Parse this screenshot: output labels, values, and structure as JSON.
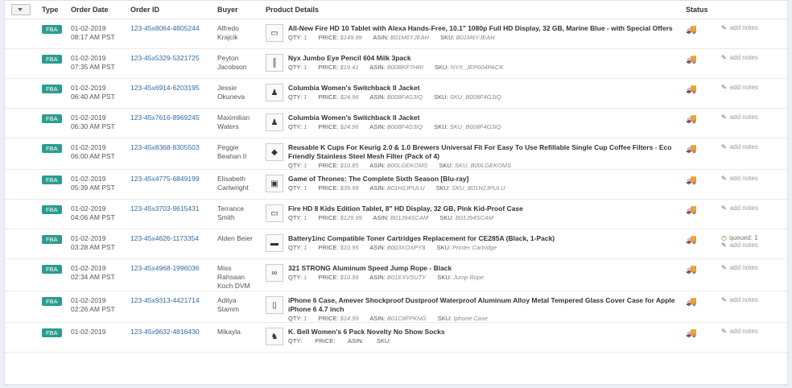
{
  "header": {
    "type": "Type",
    "order_date": "Order Date",
    "order_id": "Order ID",
    "buyer": "Buyer",
    "product_details": "Product Details",
    "status": "Status"
  },
  "labels": {
    "qty": "QTY:",
    "price": "PRICE:",
    "asin": "ASIN:",
    "sku": "SKU:",
    "add_notes": "add notes"
  },
  "colors": {
    "fba_badge": "#2a9d8f",
    "link": "#2f6aa5",
    "truck": "#6b9a2a"
  },
  "orders": [
    {
      "type": "FBA",
      "date": "01-02-2019",
      "time": "08:17 AM PST",
      "id": "123-45x8064-4805244",
      "buyer": "Alfredo Krajcik",
      "product": "All-New Fire HD 10 Tablet with Alexa Hands-Free, 10.1\" 1080p Full HD Display, 32 GB, Marine Blue - with Special Offers",
      "qty": "1",
      "price": "$149.99",
      "asin": "B01M6YJEAH",
      "sku": "B01M6YJEAH",
      "icon": "tablet-icon",
      "queued": ""
    },
    {
      "type": "FBA",
      "date": "01-02-2019",
      "time": "07:35 AM PST",
      "id": "123-45x5329-5321725",
      "buyer": "Peyton Jacobson",
      "product": "Nyx Jumbo Eye Pencil 604 Milk 3pack",
      "qty": "1",
      "price": "$19.41",
      "asin": "B00BKF7HRI",
      "sku": "NYX_JEP604PACK",
      "icon": "pencil-icon",
      "queued": ""
    },
    {
      "type": "FBA",
      "date": "01-02-2019",
      "time": "06:40 AM PST",
      "id": "123-45x6914-6203195",
      "buyer": "Jessie Okuneva",
      "product": "Columbia Women's Switchback II Jacket",
      "qty": "1",
      "price": "$24.96",
      "asin": "B008F4G3IQ",
      "sku": "SKU_B008F4G3IQ",
      "icon": "jacket-icon",
      "queued": ""
    },
    {
      "type": "FBA",
      "date": "01-02-2019",
      "time": "06:30 AM PST",
      "id": "123-45x7616-8969245",
      "buyer": "Maximilian Waters",
      "product": "Columbia Women's Switchback II Jacket",
      "qty": "1",
      "price": "$24.96",
      "asin": "B008F4G3IQ",
      "sku": "SKU_B008F4G3IQ",
      "icon": "jacket-icon",
      "queued": ""
    },
    {
      "type": "FBA",
      "date": "01-02-2019",
      "time": "06:00 AM PST",
      "id": "123-45x8368-8305503",
      "buyer": "Peggie Beahan II",
      "product": "Reusable K Cups For Keurig 2.0 & 1.0 Brewers Universal Fit For Easy To Use Refillable Single Cup Coffee Filters - Eco Friendly Stainless Steel Mesh Filter (Pack of 4)",
      "qty": "1",
      "price": "$10.85",
      "asin": "B00LGEKOMS",
      "sku": "SKU_B00LGEKOMS",
      "icon": "kcup-icon",
      "queued": ""
    },
    {
      "type": "FBA",
      "date": "01-02-2019",
      "time": "05:39 AM PST",
      "id": "123-45x4775-6849199",
      "buyer": "Elisabeth Cartwright",
      "product": "Game of Thrones: The Complete Sixth Season [Blu-ray]",
      "qty": "1",
      "price": "$39.99",
      "asin": "B01H2JPULU",
      "sku": "SKU_B01H2JPULU",
      "icon": "bluray-icon",
      "queued": ""
    },
    {
      "type": "FBA",
      "date": "01-02-2019",
      "time": "04:06 AM PST",
      "id": "123-45x3703-9615431",
      "buyer": "Terrance Smith",
      "product": "Fire HD 8 Kids Edition Tablet, 8\" HD Display, 32 GB, Pink Kid-Proof Case",
      "qty": "1",
      "price": "$129.99",
      "asin": "B01J94SCAM",
      "sku": "B01J94SCAM",
      "icon": "kids-tablet-icon",
      "queued": ""
    },
    {
      "type": "FBA",
      "date": "01-02-2019",
      "time": "03:28 AM PST",
      "id": "123-45x4626-1173354",
      "buyer": "Alden Beier",
      "product": "Battery1inc Compatible Toner Cartridges Replacement for CE285A (Black, 1-Pack)",
      "qty": "1",
      "price": "$10.95",
      "asin": "B003XOXPY8",
      "sku": "Printer Cartridge",
      "icon": "toner-icon",
      "queued": "queued: 1"
    },
    {
      "type": "FBA",
      "date": "01-02-2019",
      "time": "02:34 AM PST",
      "id": "123-45x4968-1996036",
      "buyer": "Miss Rahsaan Koch DVM",
      "product": "321 STRONG Aluminum Speed Jump Rope - Black",
      "qty": "1",
      "price": "$10.99",
      "asin": "B01EXVSUTY",
      "sku": "Jump Rope",
      "icon": "jump-rope-icon",
      "queued": ""
    },
    {
      "type": "FBA",
      "date": "01-02-2019",
      "time": "02:26 AM PST",
      "id": "123-45x9313-4421714",
      "buyer": "Aditya Stamm",
      "product": "iPhone 6 Case, Amever Shockproof Dustproof Waterproof Aluminum Alloy Metal Tempered Glass Cover Case for Apple iPhone 6 4.7 inch",
      "qty": "1",
      "price": "$14.99",
      "asin": "B01C8FPKNG",
      "sku": "Iphone Case",
      "icon": "phone-case-icon",
      "queued": ""
    },
    {
      "type": "FBA",
      "date": "01-02-2019",
      "time": "",
      "id": "123-45x9632-4816430",
      "buyer": "Mikayla",
      "product": "K. Bell Women's 6 Pack Novelty No Show Socks",
      "qty": "",
      "price": "",
      "asin": "",
      "sku": "",
      "icon": "socks-icon",
      "queued": ""
    }
  ]
}
